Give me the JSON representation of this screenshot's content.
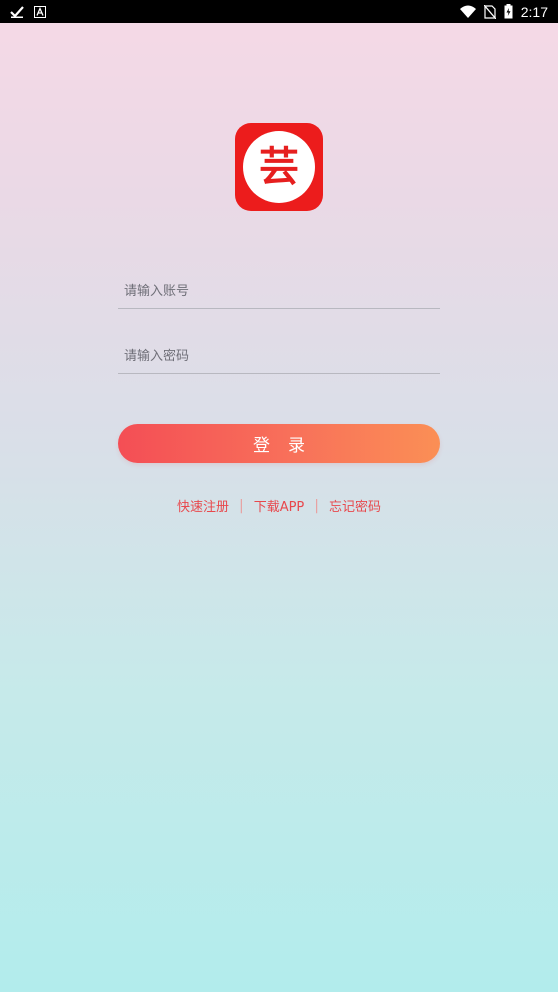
{
  "status_bar": {
    "time": "2:17",
    "left_icons": [
      "check-icon",
      "app-a-icon"
    ],
    "right_icons": [
      "wifi-icon",
      "no-sim-icon",
      "battery-charging-icon"
    ]
  },
  "logo": {
    "char": "芸",
    "bg_color": "#ec1c1c"
  },
  "form": {
    "account_placeholder": "请输入账号",
    "account_value": "",
    "password_placeholder": "请输入密码",
    "password_value": "",
    "login_label": "登录"
  },
  "links": {
    "register": "快速注册",
    "download": "下载APP",
    "forgot": "忘记密码",
    "separator": "|"
  },
  "colors": {
    "accent": "#f44e55",
    "accent_end": "#fb8f55",
    "link": "#e8484c"
  }
}
